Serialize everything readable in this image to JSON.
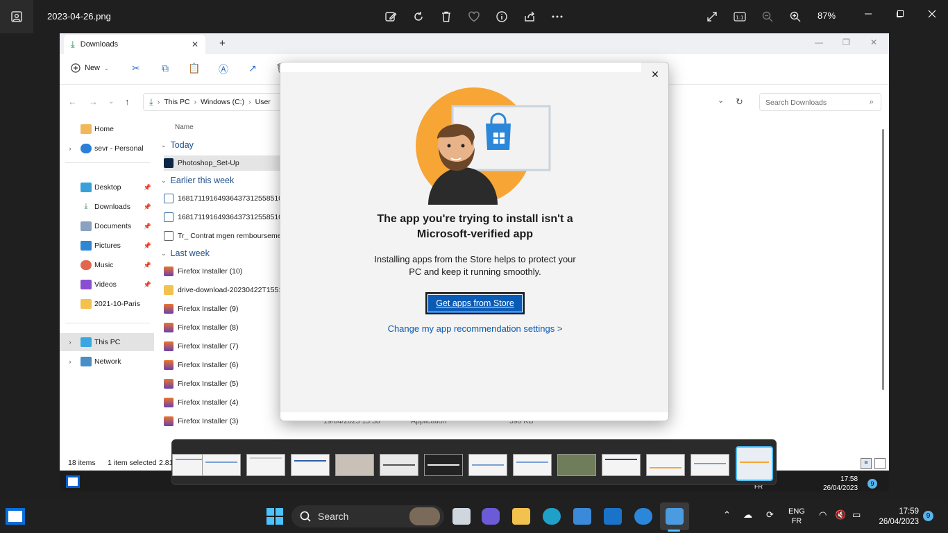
{
  "viewer": {
    "filename": "2023-04-26.png",
    "zoom": "87%",
    "fit_label": "1:1"
  },
  "explorer": {
    "tab_title": "Downloads",
    "new_label": "New",
    "breadcrumb": [
      "This PC",
      "Windows (C:)",
      "User"
    ],
    "search_placeholder": "Search Downloads",
    "column_name": "Name",
    "sidebar": {
      "home": "Home",
      "onedrive": "sevr - Personal",
      "desktop": "Desktop",
      "downloads": "Downloads",
      "documents": "Documents",
      "pictures": "Pictures",
      "music": "Music",
      "videos": "Videos",
      "paris": "2021-10-Paris",
      "thispc": "This PC",
      "network": "Network"
    },
    "groups": {
      "today": "Today",
      "earlier": "Earlier this week",
      "lastweek": "Last week"
    },
    "files": {
      "f1": "Photoshop_Set-Up",
      "f2": "168171191649364373125585103",
      "f3": "168171191649364373125585103",
      "f4": "Tr_ Contrat mgen rembourseme",
      "f5": "Firefox Installer (10)",
      "f6": "drive-download-20230422T1551",
      "f7": "Firefox Installer (9)",
      "f8": "Firefox Installer (8)",
      "f9": "Firefox Installer (7)",
      "f10": "Firefox Installer (6)",
      "f11": "Firefox Installer (5)",
      "f12": "Firefox Installer (4)",
      "f13": "Firefox Installer (3)"
    },
    "last_row": {
      "date": "19/04/2023 15:38",
      "type": "Application",
      "size": "390 KB"
    },
    "status": {
      "items": "18 items",
      "selected": "1 item selected",
      "size": "2.81"
    },
    "inner_clock": {
      "time": "17:58",
      "date": "26/04/2023",
      "lang": "FR",
      "badge": "9"
    }
  },
  "dialog": {
    "title_line1": "The app you're trying to install isn't a",
    "title_line2": "Microsoft-verified app",
    "body_line1": "Installing apps from the Store helps to protect your",
    "body_line2": "PC and keep it running smoothly.",
    "button": "Get apps from Store",
    "link": "Change my app recommendation settings",
    "link_chevron": ">"
  },
  "taskbar": {
    "search_label": "Search",
    "lang_top": "ENG",
    "lang_bottom": "FR",
    "time": "17:59",
    "date": "26/04/2023",
    "badge": "9"
  },
  "colors": {
    "accent": "#0a5bb5",
    "group_header": "#1f4e8c",
    "orange": "#f7a535",
    "taskbar": "#202020"
  }
}
